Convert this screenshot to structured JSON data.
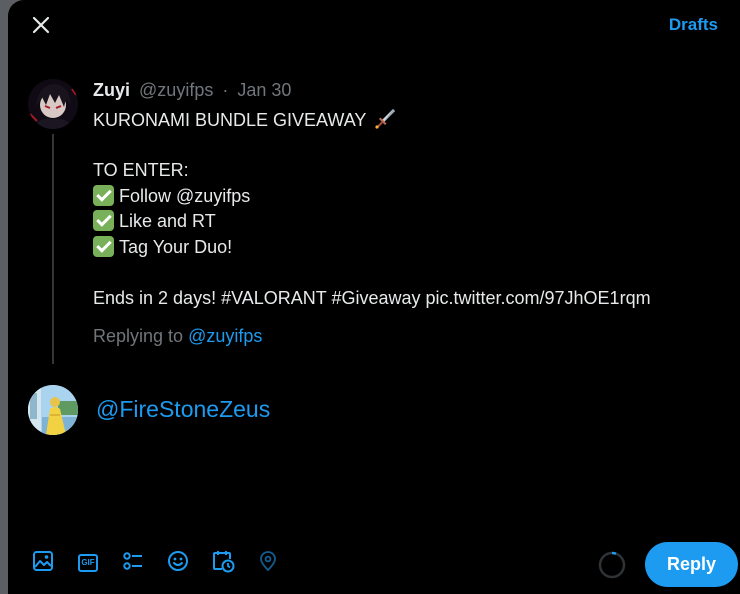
{
  "header": {
    "close_icon": "close-icon",
    "drafts_label": "Drafts"
  },
  "tweet": {
    "author_name": "Zuyi",
    "author_handle": "@zuyifps",
    "separator": "·",
    "date": "Jan 30",
    "title_line": "KURONAMI BUNDLE GIVEAWAY",
    "title_emoji": "dagger-emoji",
    "to_enter": "TO ENTER:",
    "steps": [
      "Follow @zuyifps",
      "Like and RT",
      "Tag Your Duo!"
    ],
    "ends_line": "Ends in 2 days! #VALORANT #Giveaway pic.twitter.com/97JhOE1rqm",
    "replying_prefix": "Replying to",
    "replying_handle": "@zuyifps"
  },
  "reply": {
    "text": "@FireStoneZeus"
  },
  "toolbar": {
    "icons": [
      "media-icon",
      "gif-icon",
      "poll-icon",
      "emoji-icon",
      "schedule-icon",
      "location-icon"
    ],
    "gif_text": "GIF",
    "reply_button": "Reply"
  },
  "colors": {
    "accent": "#1d9bf0",
    "background": "#000000",
    "muted_text": "#71767b",
    "primary_text": "#e7e9ea",
    "check_green": "#78b159"
  }
}
